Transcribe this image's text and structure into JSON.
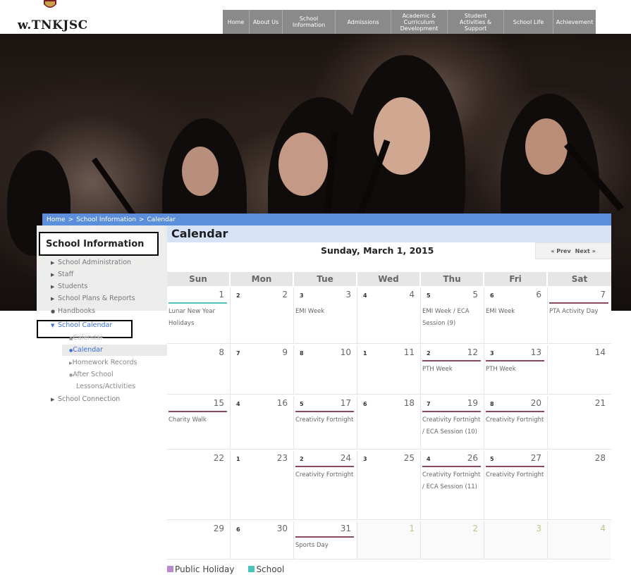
{
  "header": {
    "logo": "w.TNKJSC",
    "nav": [
      "Home",
      "About Us",
      "School\nInformation",
      "Admissions",
      "Academic &\nCurriculum\nDevelopment",
      "Student\nActivities &\nSupport",
      "School Life",
      "Achievement"
    ]
  },
  "breadcrumb": [
    "Home",
    ">",
    "School Information",
    ">",
    "Calendar"
  ],
  "sidebar": {
    "title": "School Information",
    "items": [
      "School Administration",
      "Staff",
      "Students",
      "School Plans & Reports",
      "Handbooks",
      "School Calendar",
      "School Connection"
    ],
    "subitems": [
      "Calendar",
      "Calendar",
      "Homework Records",
      "After School",
      "Lessons/Activities"
    ]
  },
  "calendar": {
    "title": "Calendar",
    "current_date": "Sunday, March 1, 2015",
    "prev": "« Prev",
    "next": "Next »",
    "days_of_week": [
      "Sun",
      "Mon",
      "Tue",
      "Wed",
      "Thu",
      "Fri",
      "Sat"
    ],
    "weeks": [
      [
        {
          "num": "1",
          "cycle": "",
          "bar": "teal",
          "events": "Lunar New Year Holidays"
        },
        {
          "num": "2",
          "cycle": "2",
          "bar": "",
          "events": ""
        },
        {
          "num": "3",
          "cycle": "3",
          "bar": "",
          "events": "EMI Week"
        },
        {
          "num": "4",
          "cycle": "4",
          "bar": "",
          "events": ""
        },
        {
          "num": "5",
          "cycle": "5",
          "bar": "",
          "events": "EMI Week / ECA Session (9)"
        },
        {
          "num": "6",
          "cycle": "6",
          "bar": "",
          "events": "EMI Week"
        },
        {
          "num": "7",
          "cycle": "",
          "bar": "plum",
          "events": "PTA Activity Day"
        }
      ],
      [
        {
          "num": "8",
          "cycle": "",
          "bar": "",
          "events": ""
        },
        {
          "num": "9",
          "cycle": "7",
          "bar": "",
          "events": ""
        },
        {
          "num": "10",
          "cycle": "8",
          "bar": "",
          "events": ""
        },
        {
          "num": "11",
          "cycle": "1",
          "bar": "",
          "events": ""
        },
        {
          "num": "12",
          "cycle": "2",
          "bar": "plum",
          "events": "PTH Week"
        },
        {
          "num": "13",
          "cycle": "3",
          "bar": "plum",
          "events": "PTH Week"
        },
        {
          "num": "14",
          "cycle": "",
          "bar": "",
          "events": ""
        }
      ],
      [
        {
          "num": "15",
          "cycle": "",
          "bar": "plum",
          "events": "Charity Walk"
        },
        {
          "num": "16",
          "cycle": "4",
          "bar": "",
          "events": ""
        },
        {
          "num": "17",
          "cycle": "5",
          "bar": "plum",
          "events": "Creativity Fortnight"
        },
        {
          "num": "18",
          "cycle": "6",
          "bar": "",
          "events": ""
        },
        {
          "num": "19",
          "cycle": "7",
          "bar": "plum",
          "events": "Creativity Fortnight / ECA Session (10)"
        },
        {
          "num": "20",
          "cycle": "8",
          "bar": "plum",
          "events": "Creativity Fortnight"
        },
        {
          "num": "21",
          "cycle": "",
          "bar": "",
          "events": ""
        }
      ],
      [
        {
          "num": "22",
          "cycle": "",
          "bar": "",
          "events": ""
        },
        {
          "num": "23",
          "cycle": "1",
          "bar": "",
          "events": ""
        },
        {
          "num": "24",
          "cycle": "2",
          "bar": "plum",
          "events": "Creativity Fortnight"
        },
        {
          "num": "25",
          "cycle": "3",
          "bar": "",
          "events": ""
        },
        {
          "num": "26",
          "cycle": "4",
          "bar": "plum",
          "events": "Creativity Fortnight / ECA Session (11)"
        },
        {
          "num": "27",
          "cycle": "5",
          "bar": "plum",
          "events": "Creativity Fortnight"
        },
        {
          "num": "28",
          "cycle": "",
          "bar": "",
          "events": ""
        }
      ],
      [
        {
          "num": "29",
          "cycle": "",
          "bar": "",
          "events": ""
        },
        {
          "num": "30",
          "cycle": "6",
          "bar": "",
          "events": ""
        },
        {
          "num": "31",
          "cycle": "",
          "bar": "plum",
          "events": "Sports Day"
        },
        {
          "num": "1",
          "cycle": "",
          "bar": "",
          "events": "",
          "other": true
        },
        {
          "num": "2",
          "cycle": "",
          "bar": "",
          "events": "",
          "other": true
        },
        {
          "num": "3",
          "cycle": "",
          "bar": "",
          "events": "",
          "other": true
        },
        {
          "num": "4",
          "cycle": "",
          "bar": "",
          "events": "",
          "other": true
        }
      ]
    ]
  },
  "legend": {
    "items": [
      {
        "label": "Public Holiday",
        "color": "#b98ad0"
      },
      {
        "label": "School",
        "color": "#49c6b8"
      }
    ]
  },
  "colors": {
    "accent_blue": "#5b8fdc",
    "title_bg": "#d6e3f7",
    "event_bar": "#8a4a5a"
  }
}
